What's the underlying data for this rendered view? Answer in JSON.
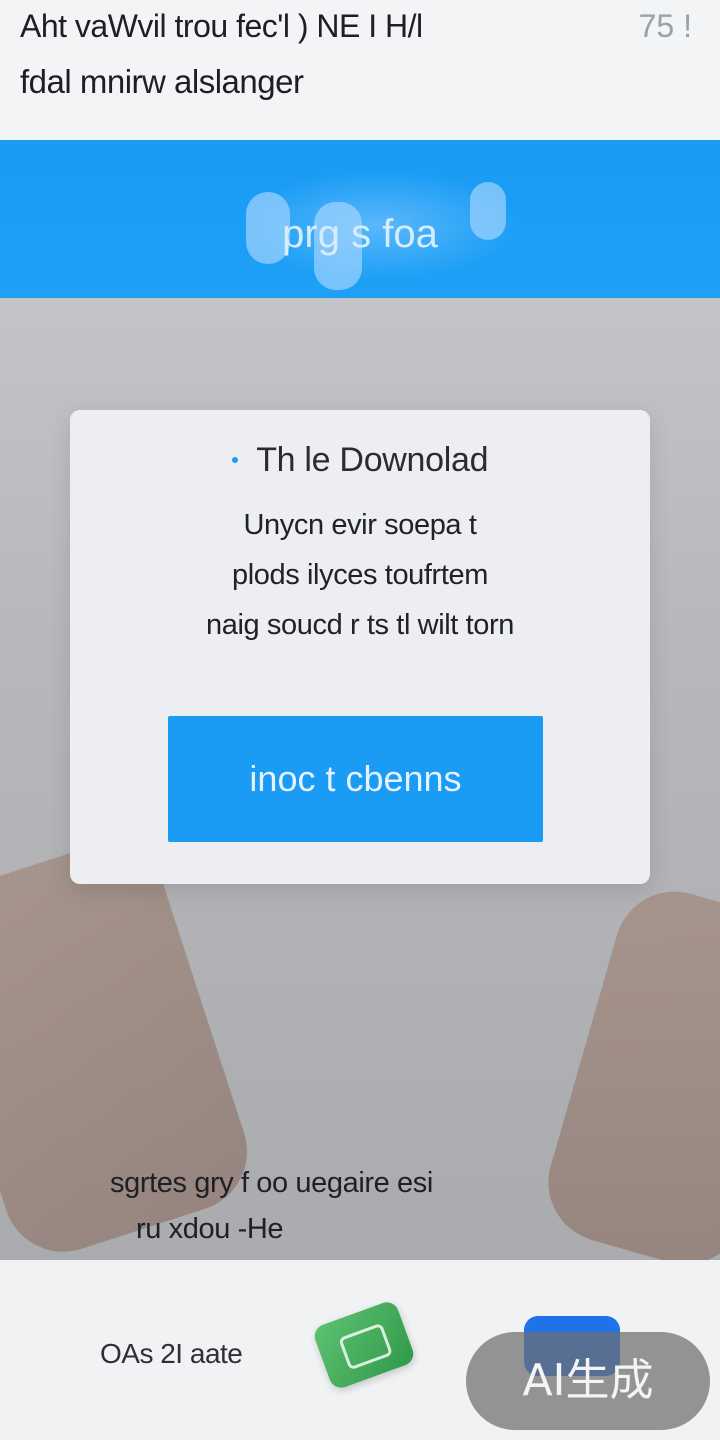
{
  "header": {
    "status_text": "Aht  vaWvil trou fec'l ) NE  I H/l",
    "status_right": "75 !",
    "subtitle": "fdal mnirw alslanger"
  },
  "banner": {
    "title": "prg  s  foa",
    "color": "#1a9bf4"
  },
  "dialog": {
    "title": "Th le Downolad",
    "body_lines": [
      "Unycn evir soepa t",
      "plods ilyces toufrtem",
      "naig soucd r ts tl wilt torn"
    ],
    "primary_button_label": "inoc t cbenns"
  },
  "caption": {
    "lines": [
      "sgrtes gry f oo uegaire esi",
      "ru xdou -He"
    ]
  },
  "bottom_bar": {
    "label": "OAs 2I aate",
    "icons": [
      "green-app-icon",
      "blue-app-icon"
    ],
    "watermark": "AI生成"
  },
  "colors": {
    "accent": "#1a9bf4",
    "header_bg": "#f3f4f6",
    "dialog_bg": "#eceef1"
  }
}
